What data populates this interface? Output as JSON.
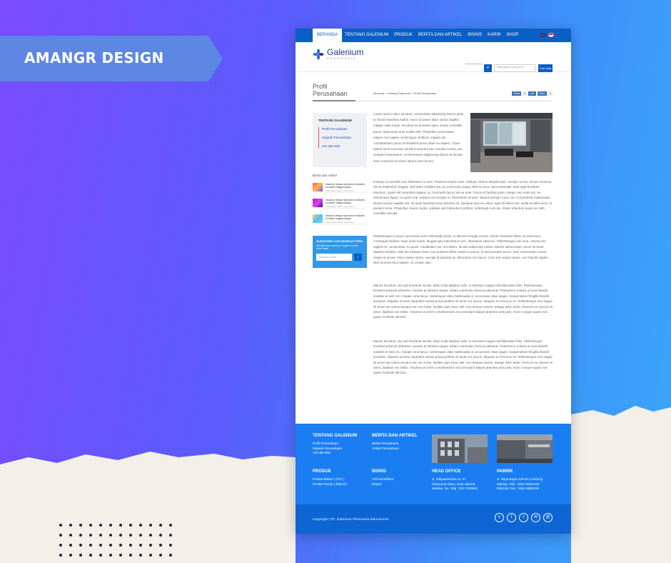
{
  "banner": {
    "brand": "AMANGR DESIGN"
  },
  "nav": {
    "items": [
      "BERANDA",
      "TENTANG GALENIUM",
      "PRODUK",
      "BERITA DAN ARTIKEL",
      "BISNIS",
      "KARIR",
      "SHOP"
    ],
    "active": "BERANDA"
  },
  "header": {
    "logo_name": "Galenium",
    "logo_sub": "PHARMASIA",
    "search_placeholder": "Masukkan kata kunci",
    "search_button": "Cari data"
  },
  "titlebar": {
    "title": "Profil Perusahaan",
    "breadcrumb": "Beranda > Tentang Galenium > Profil Perusahaan",
    "social": [
      "Tweet",
      "Like",
      "Share"
    ]
  },
  "sidebar": {
    "box_title": "TENTANG GALENIUM",
    "links": [
      "Profil Perusahaan",
      "Sejarah Perusahaan",
      "Visi dan Misi"
    ],
    "news_heading": "Berita dan Artikel",
    "news": [
      {
        "text": "vivamus tempor tincidunt ut lobortis et dolore magna aliqua",
        "date": "Tiket dalam Hari In Hammond"
      },
      {
        "text": "vivamus tempor tincidunt ut lobortis et dolore magna aliqua",
        "date": "Tiket dalam Hari In Hammond"
      },
      {
        "text": "vivamus tempor tincidunt ut lobortis et dolore magna aliqua",
        "date": "Tiket dalam Hari In Hammond"
      }
    ],
    "subscribe_title": "SUBSCRIBE OUR NEWSLETTERS",
    "subscribe_text": "We will never send you spam or some other trash",
    "subscribe_placeholder": "Type your email",
    "subscribe_button": "›"
  },
  "content": {
    "intro": "Lorem ipsum dolor sit amet, consectetur adipiscing Sed et justo ac lectus faucibus mattis. Nunc at ipsum diam varius sagittis. Integer nulla turpis, tincidunt eu posuere eget, ornare convallis purus. Maecenas ante mollis velit. Phasellus consectetur, sapien non sapien scelerisque eleifend, magna elit condimentum purus id hendrerit purus diam eu sapien. Class aptent taciti sociosqu ad litora torquent per conubia nostra, per inceptos himenaeos. Ut fermentum adipiscing dictum at lacinia enim euismod sit amet. Mauris sem lectus,",
    "p1": "tristique a convallis sed, bibendum in sem. Praesent turpis tortor, tristique dictum blandit vitae, semper ac leo. Donec rhoncus, elit at vestibulum feugiat, velit dolor sodales dui, eu commodo neque nibh eu arcu. Sed venenatis, ante eget tincidunt interdum, quam elit imperdiet magna, ac commodo lacus nisl ea ante. Fusce et facilisis justo. Integer nec enim est, eu elementum ligula. Ut quam erat, tempus vel semper in, fermentum at ante. Mauris semper nunc nec mi hendrerit malesuada. Donec lacinia sagittis nisi, sit amet faucibus risus pulvinar sit. Quisque quis leo dolor, eget tincidunt nisi. Nulla et tellus eros, id pretium tortor. Phasellus mauris turpis, sodales sed bibendum porttitor, sollicitudin non leo. Etiam interdum quam ac nibh convallis suscipit.",
    "p2": "Pellentesque in ipsum accumsan sem sollicitudin porta. In ultricies feugiat cursus. Donec hendrerit libero sit amet arcu consequat facilisis. Nam dolor turpis, feugiat eget elementum nec, bibendum vitae leo. Pellentesque nisi urna, viverra non sagittis et, consectetur eu quam. Vestibulum nec orci libero, lacinia adipiscing metus. Mauris ullamcorper, purus sit amet dapibus facilisis, nibh leo tristique risus, non pulvinar tellus massa in purus. In sed posuere purus. Sed consectetur cursus neque et auctor. Nunc metus lorem, suscipit id pulvinar ac, bibendum nec lacus. Cras sed neque neque, non blandit sapien. Sed sit amet arcu sapien, ac ornare odio.",
    "p3": "Mauris tincidunt, dui sed hendrerit iaculis, diam nulla dapibus odio, in interdum magna elit bibendum felis. Pellentesque tincidunt pulvinar pharetra. Aenean at ultricies augue. Etiam commodo rhoncus placerat. Praesent in massa ut urna blandit sodales et sed orci. Integer urna lacus, scelerisque vitae malesuada ut, accumsan vitae augue. Suspendisse fringilla blandit tincidunt. Aliquam at enim imperdiet massa porta porttitor sit amet non purus. Aliquam eu rhoncus mi. Pellentesque non augue sit amet nisi varius tempus nec nec tortor. Nullam quis risus velit, non tempus metus. Integer diam dolor, rhoncus eu viverra sit amet, dapibus nec tellus. Vivamus et lorem condimentum arcu tincidunt aliquet pharetra sed justo. Nunc congue quam non quam molestie ultricies.",
    "p4": "Mauris tincidunt, dui sed hendrerit iaculis, diam nulla dapibus odio, in interdum magna elit bibendum felis. Pellentesque tincidunt pulvinar pharetra. Aenean at ultricies augue. Etiam commodo rhoncus placerat. Praesent in massa ut urna blandit sodales et sed orci. Integer urna lacus, scelerisque vitae malesuada ut, accumsan vitae augue. Suspendisse fringilla blandit tincidunt. Aliquam at enim imperdiet massa porta porttitor sit amet non purus. Aliquam eu rhoncus mi. Pellentesque non augue sit amet nisi varius tempus nec nec tortor. Nullam quis risus velit, non tempus metus. Integer diam dolor, rhoncus eu viverra sit amet, dapibus nec tellus. Vivamus et lorem condimentum arcu tincidunt aliquet pharetra sed justo. Nunc congue quam non quam molestie ultricies."
  },
  "footer": {
    "tentang": {
      "title": "TENTANG GALENIUM",
      "links": [
        "Profil Perusahaan",
        "Sejarah Perusahaan",
        "Visi dan Misi"
      ]
    },
    "berita": {
      "title": "BERITA DAN ARTIKEL",
      "links": [
        "Berita Perusahaan",
        "Artikel Perusahaan"
      ]
    },
    "produk": {
      "title": "PRODUK",
      "links": [
        "Produk Bebas ( OTC )",
        "Produk Resep ( Ethical )"
      ]
    },
    "bisnis": {
      "title": "BISNIS",
      "links": [
        "Toll manufaktur",
        "Ekspor"
      ]
    },
    "head_office": {
      "title": "HEAD OFFICE",
      "lines": [
        "Jl. Adityawarman no. 67",
        "Kebayoran Baru, Kota Jakarta",
        "Selatan. No. Telp : 021-7228601"
      ]
    },
    "pabrik": {
      "title": "PABRIK",
      "lines": [
        "Jl. Raya Bogor KM 51.5 Kedung",
        "Malang. Telp : 0251-8652140/",
        "8652161 Fax : 0251-8652160"
      ]
    },
    "copyright": "Copyright | PT. Galenium Pharmasia laboratories",
    "social_icons": [
      "vimeo-icon",
      "facebook-icon",
      "twitter-icon",
      "chat-icon",
      "mail-icon"
    ]
  },
  "colors": {
    "primary": "#0a5fc4",
    "footer": "#1a7ef2",
    "accent_red": "#e34c4c"
  }
}
